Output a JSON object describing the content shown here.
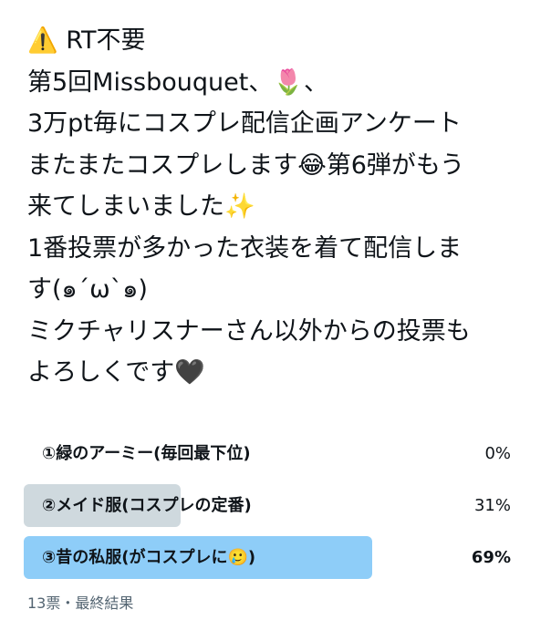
{
  "tweet": {
    "lines": [
      "⚠️ RT不要",
      "第5回Missbouquet、🌷、",
      "3万pt毎にコスプレ配信企画アンケート",
      "またまたコスプレします😂第6弾がもう",
      "来てしまいました✨",
      "1番投票が多かった衣装を着て配信しま",
      "す(๑´ω`๑)",
      "ミクチャリスナーさん以外からの投票も",
      "よろしくです🖤"
    ]
  },
  "poll": {
    "options": [
      {
        "label": "①緑のアーミー(毎回最下位)",
        "percent_text": "0%",
        "percent": 0,
        "winner": false
      },
      {
        "label": "②メイド服(コスプレの定番)",
        "percent_text": "31%",
        "percent": 31,
        "winner": false
      },
      {
        "label": "③昔の私服(がコスプレに🥲)",
        "percent_text": "69%",
        "percent": 69,
        "winner": true
      }
    ],
    "meta": "13票・最終結果",
    "colors": {
      "fill_default": "#cfd9de",
      "fill_winner": "#8ecdf8"
    }
  }
}
